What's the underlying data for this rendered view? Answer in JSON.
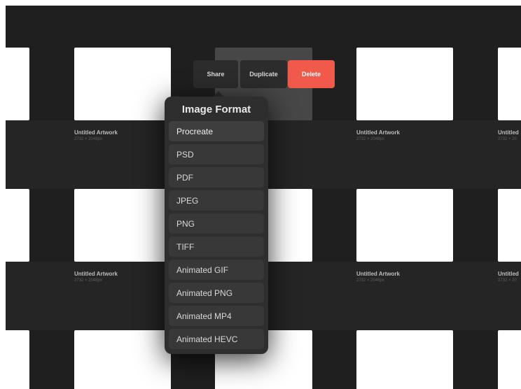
{
  "artworks": {
    "title": "Untitled Artwork",
    "dimensions": "2732 × 2048px",
    "partial_title": "Untitled",
    "partial_dimensions": "2732 × 20"
  },
  "actions": {
    "share_label": "Share",
    "duplicate_label": "Duplicate",
    "delete_label": "Delete"
  },
  "export_popover": {
    "title": "Image Format",
    "items": [
      {
        "label": "Procreate"
      },
      {
        "label": "PSD"
      },
      {
        "label": "PDF"
      },
      {
        "label": "JPEG"
      },
      {
        "label": "PNG"
      },
      {
        "label": "TIFF"
      },
      {
        "label": "Animated GIF"
      },
      {
        "label": "Animated PNG"
      },
      {
        "label": "Animated MP4"
      },
      {
        "label": "Animated HEVC"
      }
    ]
  },
  "colors": {
    "background": "#1f1f1f",
    "delete": "#f05a4b",
    "popover": "#2e2e2e"
  }
}
